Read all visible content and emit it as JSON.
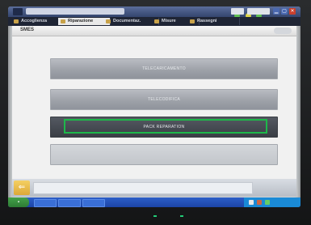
{
  "window": {
    "title": "",
    "controls": [
      "minimize",
      "maximize",
      "close"
    ]
  },
  "tabs": [
    {
      "label": "Accoglienza",
      "icon": "house-icon",
      "active": false
    },
    {
      "label": "Riparazione",
      "icon": "wrench-icon",
      "active": true
    },
    {
      "label": "Documentaz.",
      "icon": "book-icon",
      "active": false
    },
    {
      "label": "Misure",
      "icon": "meter-icon",
      "active": false
    },
    {
      "label": "Rassegni",
      "icon": "folder-icon",
      "active": false
    }
  ],
  "page": {
    "title": "SMES"
  },
  "menu": {
    "items": [
      {
        "label": "TELECARICAMENTO"
      },
      {
        "label": "TELECODIFICA"
      },
      {
        "label": "PACK REPARATION"
      },
      {
        "label": ""
      }
    ],
    "selected_index": 2
  },
  "footer": {
    "back_icon": "back-arrow-icon"
  },
  "colors": {
    "selection": "#1db84a",
    "menu_button": "#9ea2a9",
    "selected_button": "#3a3e45",
    "back_button": "#e8b84a",
    "taskbar": "#2457c4"
  }
}
